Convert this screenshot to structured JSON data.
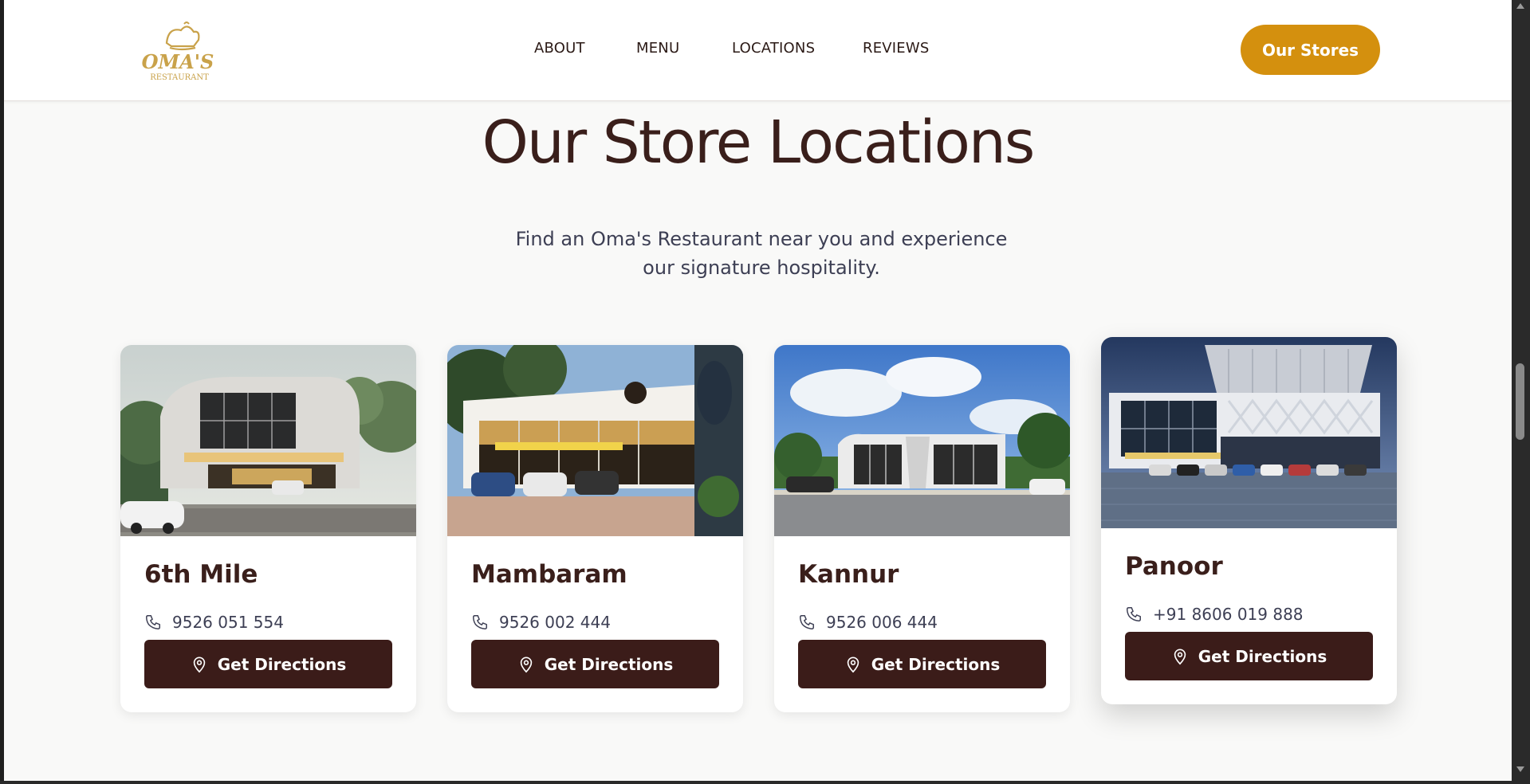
{
  "header": {
    "logo": {
      "name": "OMA'S",
      "tagline": "RESTAURANT"
    },
    "nav": [
      {
        "label": "ABOUT"
      },
      {
        "label": "MENU"
      },
      {
        "label": "LOCATIONS"
      },
      {
        "label": "REVIEWS"
      }
    ],
    "cta_label": "Our Stores"
  },
  "section": {
    "title": "Our Store Locations",
    "subtitle": "Find an Oma's Restaurant near you and experience our signature hospitality."
  },
  "stores": [
    {
      "name": "6th Mile",
      "phone": "9526 051 554",
      "button": "Get Directions"
    },
    {
      "name": "Mambaram",
      "phone": "9526 002 444",
      "button": "Get Directions"
    },
    {
      "name": "Kannur",
      "phone": "9526 006 444",
      "button": "Get Directions"
    },
    {
      "name": "Panoor",
      "phone": "+91 8606 019 888",
      "button": "Get Directions"
    }
  ],
  "colors": {
    "accent": "#d4900e",
    "brand_dark": "#3b1c19",
    "heading": "#3a1f1b",
    "body_text": "#3d3f54",
    "page_bg": "#f9f9f8",
    "logo_gold": "#c9a24a"
  },
  "icons": {
    "phone": "phone-icon",
    "directions": "map-pin-icon"
  }
}
